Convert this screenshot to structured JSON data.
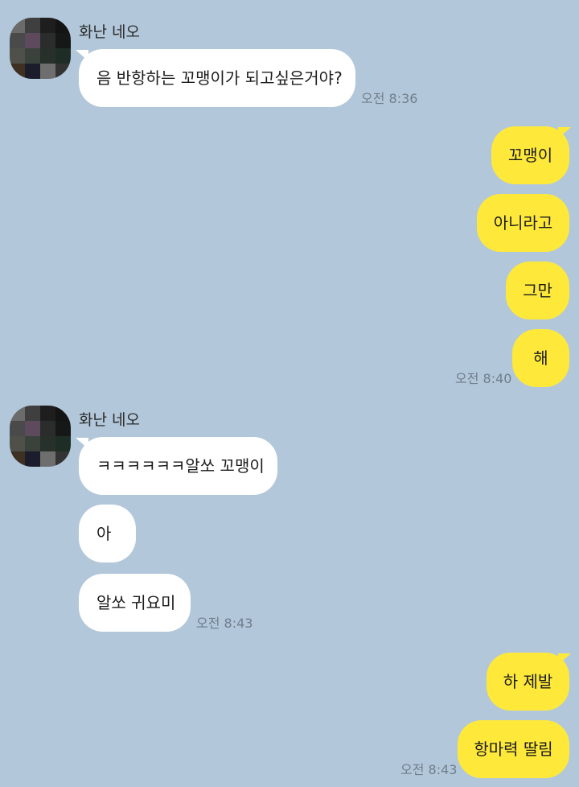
{
  "colors": {
    "background": "#b2c7da",
    "incoming_bubble": "#ffffff",
    "outgoing_bubble": "#fee93b",
    "timestamp": "#6f7e8c"
  },
  "groups": [
    {
      "sender": "화난 네오",
      "direction": "in",
      "messages": [
        "음 반항하는 꼬맹이가 되고싶은거야?"
      ],
      "time": "오전 8:36"
    },
    {
      "direction": "out",
      "messages": [
        "꼬맹이",
        "아니라고",
        "그만",
        "해"
      ],
      "time": "오전 8:40"
    },
    {
      "sender": "화난 네오",
      "direction": "in",
      "messages": [
        "ㅋㅋㅋㅋㅋㅋ알쏘 꼬맹이",
        "아",
        "알쏘 귀요미"
      ],
      "time": "오전 8:43"
    },
    {
      "direction": "out",
      "messages": [
        "하 제발",
        "항마력 딸림"
      ],
      "time": "오전 8:43"
    }
  ]
}
